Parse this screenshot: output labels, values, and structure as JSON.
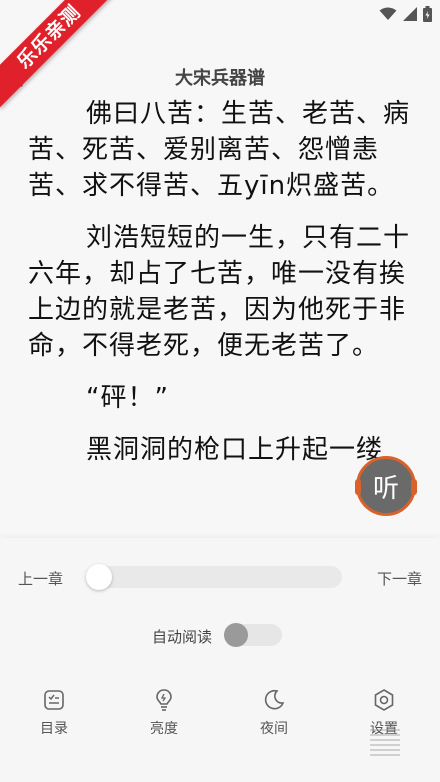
{
  "watermark": "乐乐亲测",
  "header": {
    "title": "大宋兵器谱"
  },
  "content": {
    "paragraphs": [
      "佛曰八苦：生苦、老苦、病苦、死苦、爱别离苦、怨憎恚苦、求不得苦、五yīn炽盛苦。",
      "刘浩短短的一生，只有二十六年，却占了七苦，唯一没有挨上边的就是老苦，因为他死于非命，不得老死，便无老苦了。",
      "“砰！”",
      "黑洞洞的枪口上升起一缕"
    ]
  },
  "listen_button": {
    "label": "听"
  },
  "controls": {
    "prev_chapter": "上一章",
    "next_chapter": "下一章",
    "progress": 0,
    "auto_read_label": "自动阅读",
    "auto_read_on": false
  },
  "tabs": [
    {
      "label": "目录",
      "icon": "toc-icon"
    },
    {
      "label": "亮度",
      "icon": "brightness-icon"
    },
    {
      "label": "夜间",
      "icon": "moon-icon"
    },
    {
      "label": "设置",
      "icon": "settings-icon"
    }
  ],
  "colors": {
    "accent": "#d9622b",
    "ribbon": "#e0202a"
  }
}
